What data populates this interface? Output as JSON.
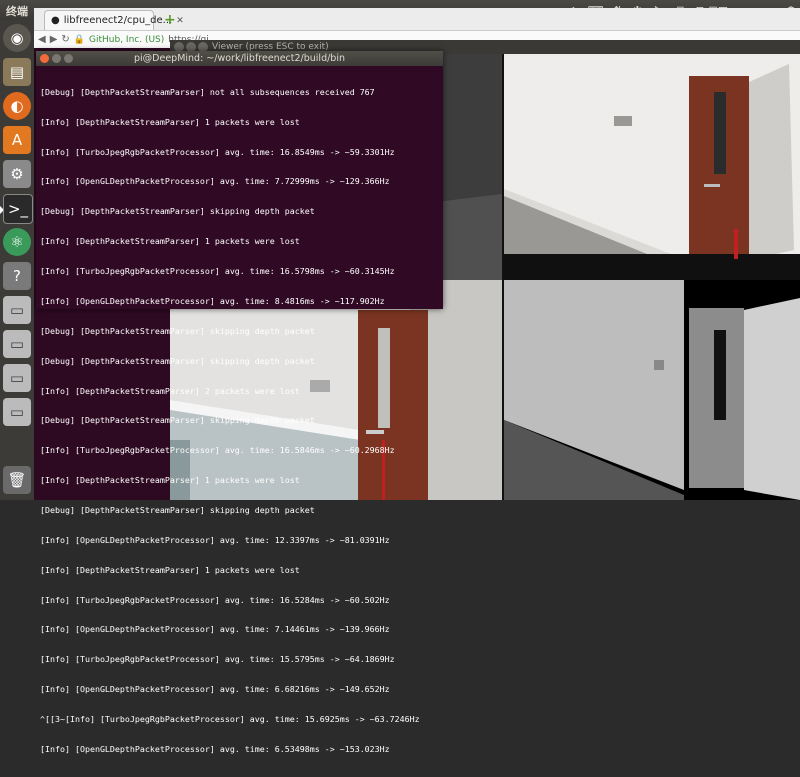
{
  "panel": {
    "title": "终端",
    "clock": "8月 4日 周四 20:22:28"
  },
  "launcher": {
    "items": [
      "ubuntu-dash",
      "files",
      "firefox",
      "software-center",
      "system-settings",
      "terminal",
      "atom",
      "unknown",
      "drive-1",
      "drive-2",
      "drive-3",
      "drive-4",
      "trash"
    ]
  },
  "browser": {
    "tab_label": "libfreenect2/cpu_de...",
    "cert": "GitHub, Inc. (US)",
    "url": "https://gi"
  },
  "viewer": {
    "title": "Viewer (press ESC to exit)"
  },
  "terminal": {
    "title": "pi@DeepMind: ~/work/libfreenect2/build/bin",
    "lines": [
      "[Debug] [DepthPacketStreamParser] not all subsequences received 767",
      "[Info] [DepthPacketStreamParser] 1 packets were lost",
      "[Info] [TurboJpegRgbPacketProcessor] avg. time: 16.8549ms -> ~59.3301Hz",
      "[Info] [OpenGLDepthPacketProcessor] avg. time: 7.72999ms -> ~129.366Hz",
      "[Debug] [DepthPacketStreamParser] skipping depth packet",
      "[Info] [DepthPacketStreamParser] 1 packets were lost",
      "[Info] [TurboJpegRgbPacketProcessor] avg. time: 16.5798ms -> ~60.3145Hz",
      "[Info] [OpenGLDepthPacketProcessor] avg. time: 8.4816ms -> ~117.902Hz",
      "[Debug] [DepthPacketStreamParser] skipping depth packet",
      "[Debug] [DepthPacketStreamParser] skipping depth packet",
      "[Info] [DepthPacketStreamParser] 2 packets were lost",
      "[Debug] [DepthPacketStreamParser] skipping depth packet",
      "[Info] [TurboJpegRgbPacketProcessor] avg. time: 16.5846ms -> ~60.2968Hz",
      "[Info] [DepthPacketStreamParser] 1 packets were lost",
      "[Debug] [DepthPacketStreamParser] skipping depth packet",
      "[Info] [OpenGLDepthPacketProcessor] avg. time: 12.3397ms -> ~81.0391Hz",
      "[Info] [DepthPacketStreamParser] 1 packets were lost",
      "[Info] [TurboJpegRgbPacketProcessor] avg. time: 16.5284ms -> ~60.502Hz",
      "[Info] [OpenGLDepthPacketProcessor] avg. time: 7.14461ms -> ~139.966Hz",
      "[Info] [TurboJpegRgbPacketProcessor] avg. time: 15.5795ms -> ~64.1869Hz",
      "[Info] [OpenGLDepthPacketProcessor] avg. time: 6.68216ms -> ~149.652Hz",
      "^[[3~[Info] [TurboJpegRgbPacketProcessor] avg. time: 15.6925ms -> ~63.7246Hz",
      "[Info] [OpenGLDepthPacketProcessor] avg. time: 6.53498ms -> ~153.023Hz"
    ]
  },
  "strip": {
    "chars": [
      "[I",
      "[I",
      "[I",
      "[I"
    ]
  },
  "colors": {
    "terminal_bg": "#300a24",
    "launcher_bg": "#3c3b37",
    "panel_bg": "#3c3b37",
    "door": "#7a3421"
  }
}
